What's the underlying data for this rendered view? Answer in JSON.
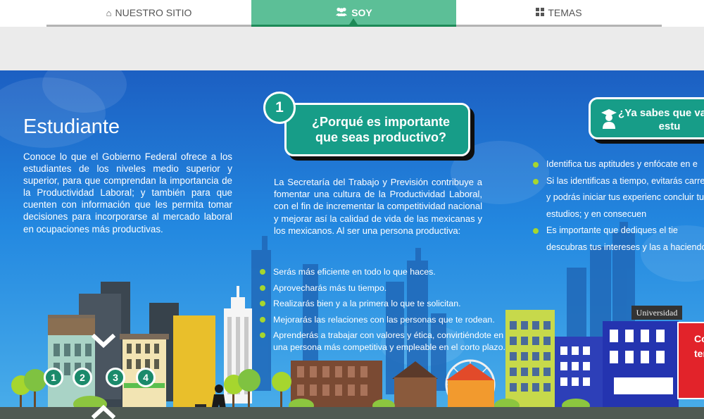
{
  "nav": {
    "tabs": [
      {
        "label": "NUESTRO SITIO",
        "icon": "home-icon"
      },
      {
        "label": "SOY",
        "icon": "users-icon",
        "active": true
      },
      {
        "label": "TEMAS",
        "icon": "grid-icon"
      }
    ]
  },
  "colors": {
    "accent_green": "#5cbf97",
    "callout_teal": "#179d88",
    "bullet_lime": "#a6d62e",
    "sky_blue": "#1c5fc2"
  },
  "section": {
    "title": "Estudiante",
    "intro": "Conoce lo que el Gobierno Federal ofrece a los estudiantes de los niveles medio superior y superior, para que comprendan la importancia de la Productividad Laboral; y también para que cuenten con información que les permita tomar decisiones para incorporarse al mercado laboral en ocupaciones más productivas."
  },
  "block1": {
    "number": "1",
    "heading": "¿Porqué es importante que seas productivo?",
    "paragraph": "La Secretaría del Trabajo y Previsión contribuye a fomentar una cultura de la Productividad Laboral, con el fin de incrementar la competitividad nacional y mejorar así la calidad de vida de las mexicanas y los mexicanos. Al ser una persona productiva:",
    "bullets": [
      "Serás más eficiente en todo lo que haces.",
      "Aprovecharás más tu tiempo.",
      "Realizarás bien y a la primera lo que te solicitan.",
      "Mejorarás las relaciones con las personas que te rodean.",
      "Aprenderás a trabajar con valores y ética, convirtiéndote en una persona más competitiva y empleable en el corto plazo."
    ]
  },
  "block2": {
    "heading": "¿Ya sabes que vas a estu",
    "bullets": [
      "Identifica tus aptitudes y enfócate en e",
      "Si las identificas a tiempo, evitarás carrera y podrás iniciar tus experienc concluir tus estudios; y en consecuen",
      "Es importante que dediques el tie descubras tus intereses y las a haciendo."
    ]
  },
  "city": {
    "university_sign": "Universidad",
    "red_sign": "Co ten"
  },
  "steps": [
    "1",
    "2",
    "3",
    "4"
  ]
}
